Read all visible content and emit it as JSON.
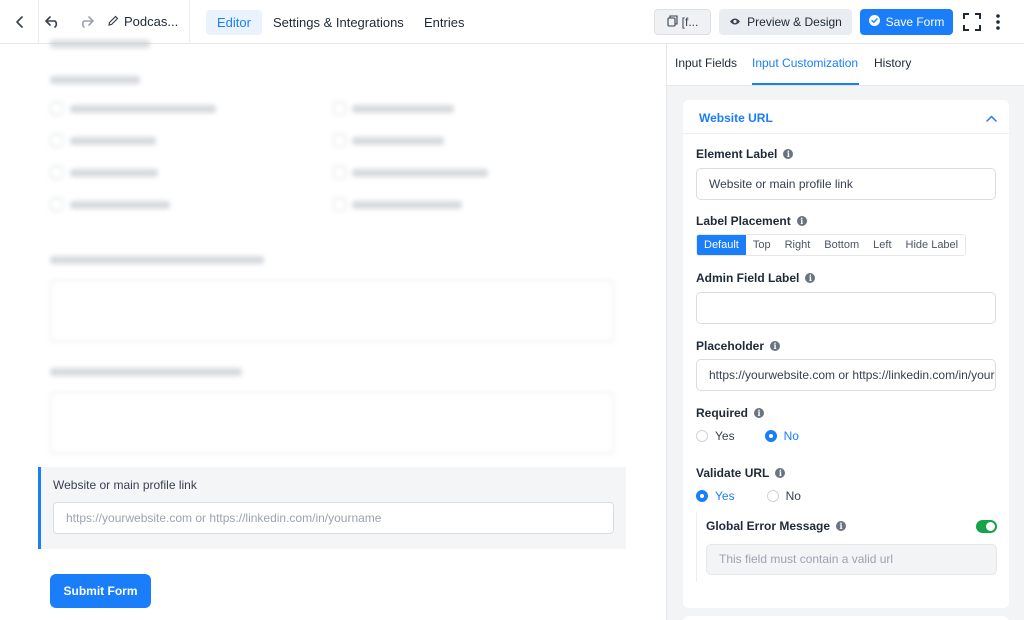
{
  "topbar": {
    "form_name": "Podcas...",
    "tabs": [
      {
        "label": "Editor",
        "active": true
      },
      {
        "label": "Settings & Integrations",
        "active": false
      },
      {
        "label": "Entries",
        "active": false
      }
    ],
    "shortcode_label": "[f...",
    "preview_label": "Preview & Design",
    "save_label": "Save Form"
  },
  "canvas": {
    "selected_field": {
      "label": "Website or main profile link",
      "placeholder": "https://yourwebsite.com or https://linkedin.com/in/yourname"
    },
    "submit_label": "Submit Form"
  },
  "panel": {
    "tabs": [
      {
        "label": "Input Fields",
        "active": false
      },
      {
        "label": "Input Customization",
        "active": true
      },
      {
        "label": "History",
        "active": false
      }
    ],
    "card_title": "Website URL",
    "element_label": {
      "label": "Element Label",
      "value": "Website or main profile link"
    },
    "label_placement": {
      "label": "Label Placement",
      "options": [
        "Default",
        "Top",
        "Right",
        "Bottom",
        "Left",
        "Hide Label"
      ],
      "selected": "Default"
    },
    "admin_field_label": {
      "label": "Admin Field Label",
      "value": ""
    },
    "placeholder": {
      "label": "Placeholder",
      "value": "https://yourwebsite.com or https://linkedin.com/in/yourname"
    },
    "required": {
      "label": "Required",
      "yes": "Yes",
      "no": "No",
      "selected": "No"
    },
    "validate_url": {
      "label": "Validate URL",
      "yes": "Yes",
      "no": "No",
      "selected": "Yes"
    },
    "global_error": {
      "label": "Global Error Message",
      "enabled": true,
      "placeholder": "This field must contain a valid url"
    }
  },
  "colors": {
    "accent": "#1a7efb",
    "toggle_on": "#16a34a"
  }
}
